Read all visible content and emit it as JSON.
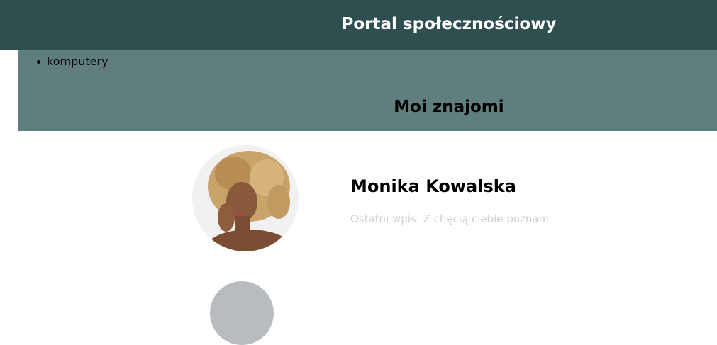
{
  "header": {
    "title": "Portal społecznościowy"
  },
  "sidebar": {
    "items": [
      {
        "label": "....."
      },
      {
        "label": "komputery"
      }
    ]
  },
  "section": {
    "title": "Moi znajomi"
  },
  "friends": [
    {
      "name": "Monika Kowalska",
      "post_prefix": "Ostatni wpis: ",
      "post_text": "Z chęcią ciebie poznam"
    }
  ],
  "colors": {
    "header_bg": "#2f4f4e",
    "section_bg": "#607e7d",
    "post_text": "#d0d0d0"
  }
}
